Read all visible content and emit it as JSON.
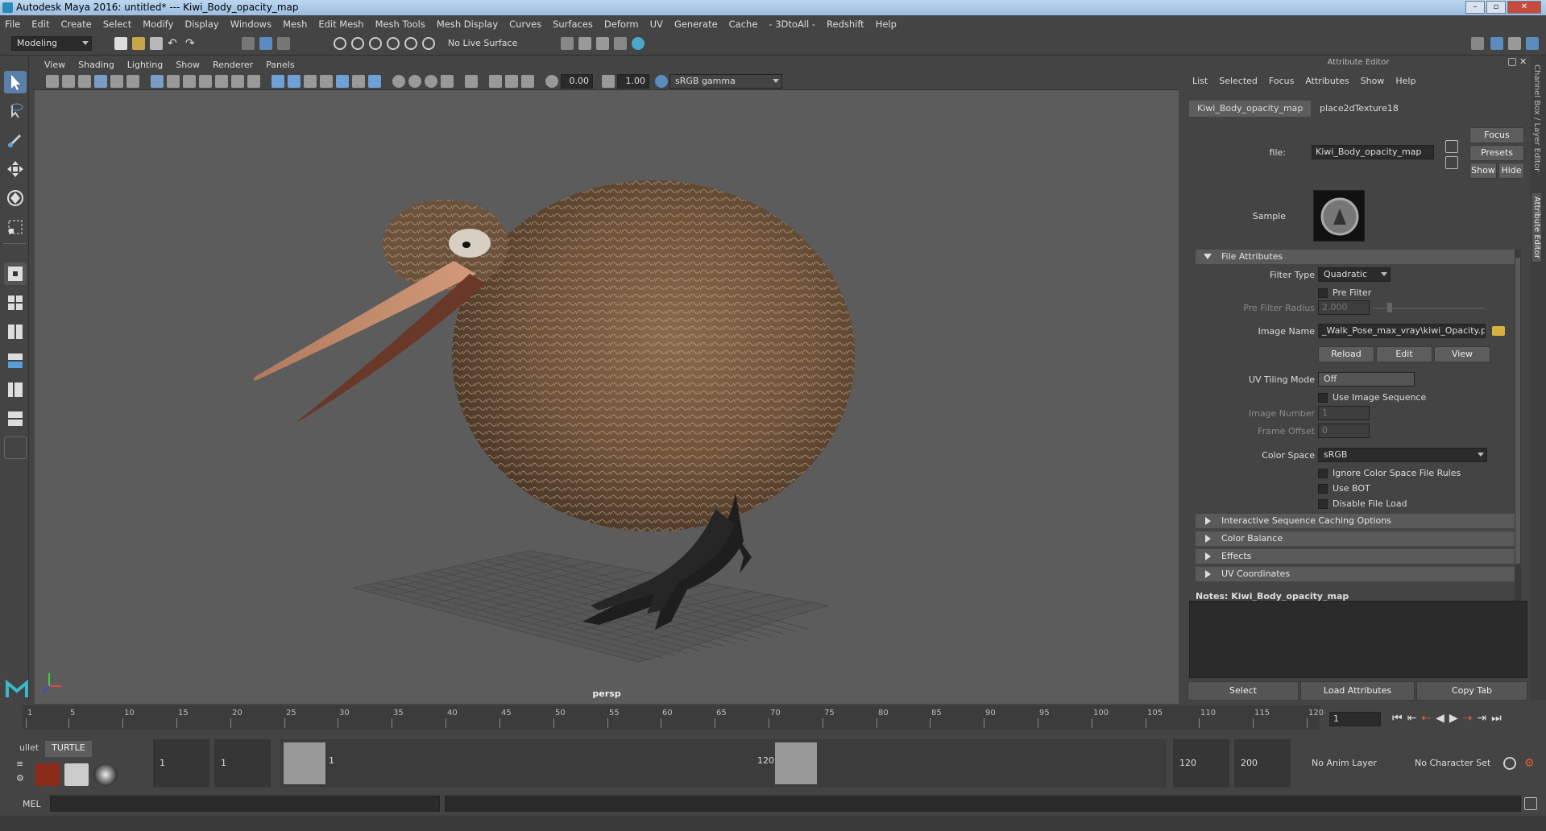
{
  "window": {
    "title": "Autodesk Maya 2016: untitled*   ---   Kiwi_Body_opacity_map"
  },
  "menubar": [
    "File",
    "Edit",
    "Create",
    "Select",
    "Modify",
    "Display",
    "Windows",
    "Mesh",
    "Edit Mesh",
    "Mesh Tools",
    "Mesh Display",
    "Curves",
    "Surfaces",
    "Deform",
    "UV",
    "Generate",
    "Cache",
    "- 3DtoAll -",
    "Redshift",
    "Help"
  ],
  "shelf": {
    "mode": "Modeling",
    "live_surface": "No Live Surface"
  },
  "viewport": {
    "menu": [
      "View",
      "Shading",
      "Lighting",
      "Show",
      "Renderer",
      "Panels"
    ],
    "field_exposure": "0.00",
    "field_gamma": "1.00",
    "color_space": "sRGB gamma",
    "camera_label": "persp"
  },
  "attribute_editor": {
    "title": "Attribute Editor",
    "menu": [
      "List",
      "Selected",
      "Focus",
      "Attributes",
      "Show",
      "Help"
    ],
    "tabs": [
      "Kiwi_Body_opacity_map",
      "place2dTexture18"
    ],
    "file_label": "file:",
    "file_value": "Kiwi_Body_opacity_map",
    "buttons": {
      "focus": "Focus",
      "presets": "Presets",
      "show": "Show",
      "hide": "Hide"
    },
    "sample_label": "Sample",
    "section_file_attributes": "File Attributes",
    "filter_type_label": "Filter Type",
    "filter_type_value": "Quadratic",
    "pre_filter": "Pre Filter",
    "pre_filter_radius_label": "Pre Filter Radius",
    "pre_filter_radius_value": "2.000",
    "image_name_label": "Image Name",
    "image_name_value": "_Walk_Pose_max_vray\\kiwi_Opacity.png",
    "reload": "Reload",
    "edit": "Edit",
    "view": "View",
    "uv_tiling_label": "UV Tiling Mode",
    "uv_tiling_value": "Off",
    "use_image_sequence": "Use Image Sequence",
    "image_number_label": "Image Number",
    "image_number_value": "1",
    "frame_offset_label": "Frame Offset",
    "frame_offset_value": "0",
    "color_space_label": "Color Space",
    "color_space_value": "sRGB",
    "ignore_rules": "Ignore Color Space File Rules",
    "use_bot": "Use BOT",
    "disable_file_load": "Disable File Load",
    "collapsed_sections": [
      "Interactive Sequence Caching Options",
      "Color Balance",
      "Effects",
      "UV Coordinates"
    ],
    "notes_label": "Notes:  Kiwi_Body_opacity_map",
    "bottom_buttons": [
      "Select",
      "Load Attributes",
      "Copy Tab"
    ],
    "side_tabs": [
      "Channel Box / Layer Editor",
      "Attribute Editor"
    ]
  },
  "timeline": {
    "ticks": [
      "1",
      "5",
      "10",
      "15",
      "20",
      "25",
      "30",
      "35",
      "40",
      "45",
      "50",
      "55",
      "60",
      "65",
      "70",
      "75",
      "80",
      "85",
      "90",
      "95",
      "100",
      "105",
      "110",
      "115",
      "120"
    ],
    "current_frame": "1"
  },
  "range": {
    "shelf_tabs": [
      "ullet",
      "TURTLE"
    ],
    "start": "1",
    "playback_start": "1",
    "range_left": "1",
    "range_right": "120",
    "playback_end": "120",
    "end": "200",
    "anim_layer": "No Anim Layer",
    "character_set": "No Character Set"
  },
  "cmdline": {
    "label": "MEL"
  }
}
